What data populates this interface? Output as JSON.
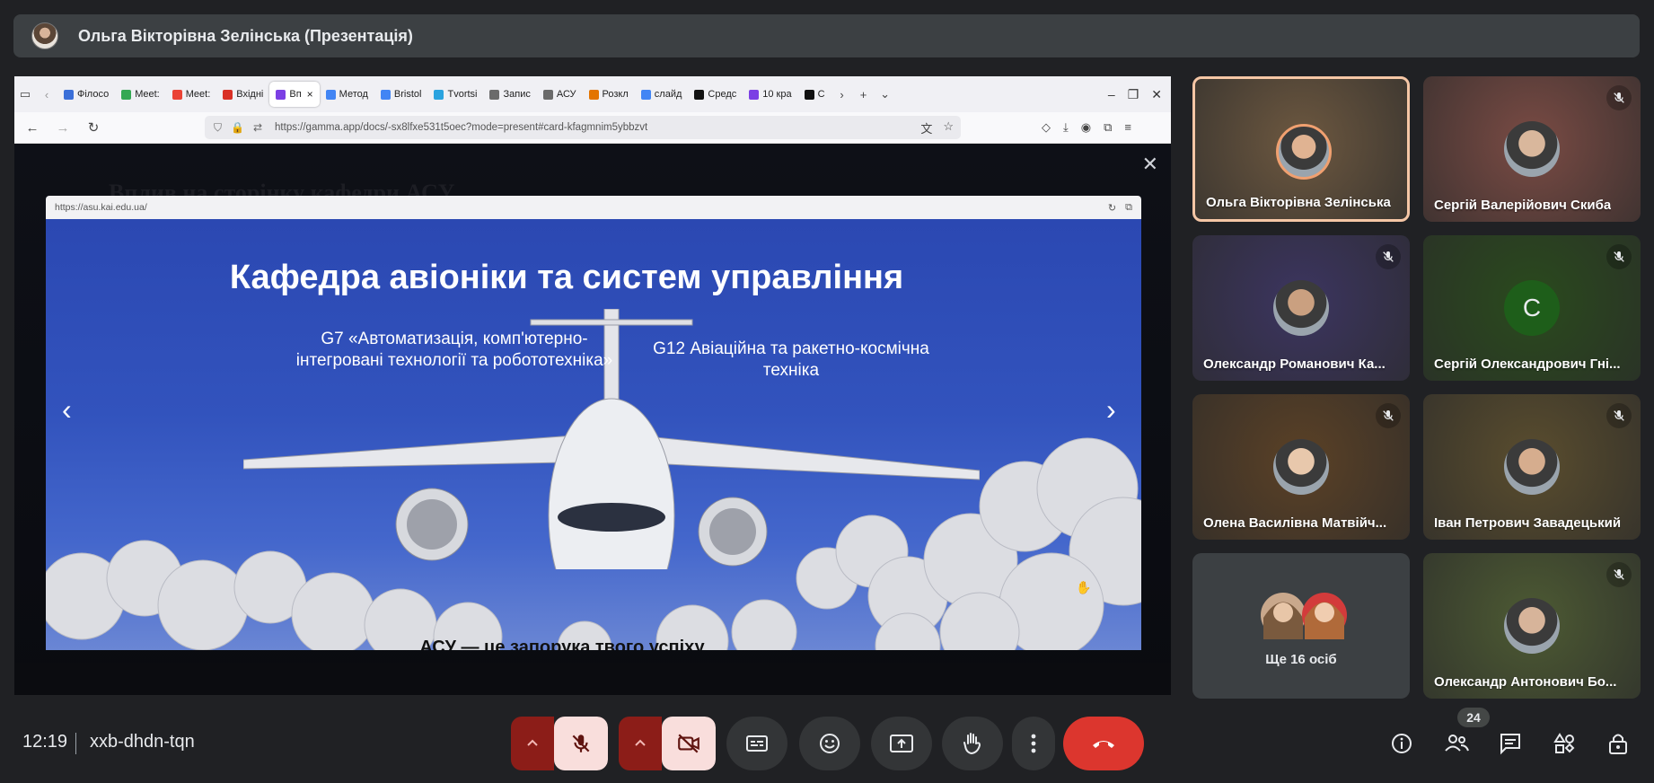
{
  "presenter": {
    "name": "Ольга Вікторівна Зелінська (Презентація)"
  },
  "browser": {
    "tabs": [
      {
        "label": "Філосо",
        "color": "#3b6fd8"
      },
      {
        "label": "Meet:",
        "color": "#34a853"
      },
      {
        "label": "Meet:",
        "color": "#ea4335"
      },
      {
        "label": "Вхідні",
        "color": "#d93025"
      },
      {
        "label": "Вп",
        "color": "#7b3fe4",
        "active": true
      },
      {
        "label": "Метод",
        "color": "#4285f4"
      },
      {
        "label": "Bristol",
        "color": "#4285f4"
      },
      {
        "label": "Tvortsi",
        "color": "#2aa3df"
      },
      {
        "label": "Запис",
        "color": "#6b6b6b"
      },
      {
        "label": "АСУ",
        "color": "#6b6b6b"
      },
      {
        "label": "Розкл",
        "color": "#e37400"
      },
      {
        "label": "слайд",
        "color": "#4285f4"
      },
      {
        "label": "Средс",
        "color": "#111111"
      },
      {
        "label": "10 кра",
        "color": "#7b3fe4"
      },
      {
        "label": "C",
        "color": "#111111"
      }
    ],
    "url": "https://gamma.app/docs/-sx8lfxe531t5oec?mode=present#card-kfagmnim5ybbzvt"
  },
  "presentation": {
    "bg_heading": "Вплив на сторінку кафедри АСУ",
    "embed_url": "https://asu.kai.edu.ua/",
    "slide_title": "Кафедра авіоніки та систем управління",
    "specialty_left": "G7 «Автоматизація, комп'ютерно-інтегровані технології та робототехніка»",
    "specialty_right": "G12 Авіаційна та ракетно-космічна техніка",
    "slide_bottom": "АСУ — це запорука твого успіху"
  },
  "participants": [
    {
      "name": "Ольга Вікторівна Зелінська",
      "active": true,
      "muted": false,
      "bg": "#6d5840"
    },
    {
      "name": "Сергій Валерійович Скиба",
      "muted": true,
      "bg": "#7a4b44"
    },
    {
      "name": "Олександр Романович Ка...",
      "muted": true,
      "bg": "#3c3560"
    },
    {
      "name": "Сергій Олександрович Гні...",
      "muted": true,
      "bg": "#2a4a1d",
      "initial": "С"
    },
    {
      "name": "Олена Василівна Матвійч...",
      "muted": true,
      "bg": "#5b4126"
    },
    {
      "name": "Іван Петрович Завадецький",
      "muted": true,
      "bg": "#5a4d2e"
    },
    {
      "name": "Олександр Антонович Бо...",
      "muted": true,
      "bg": "#4d5a33"
    }
  ],
  "more_participants": "Ще 16 осіб",
  "footer": {
    "time": "12:19",
    "meeting_code": "xxb-dhdn-tqn",
    "people_count": "24"
  }
}
